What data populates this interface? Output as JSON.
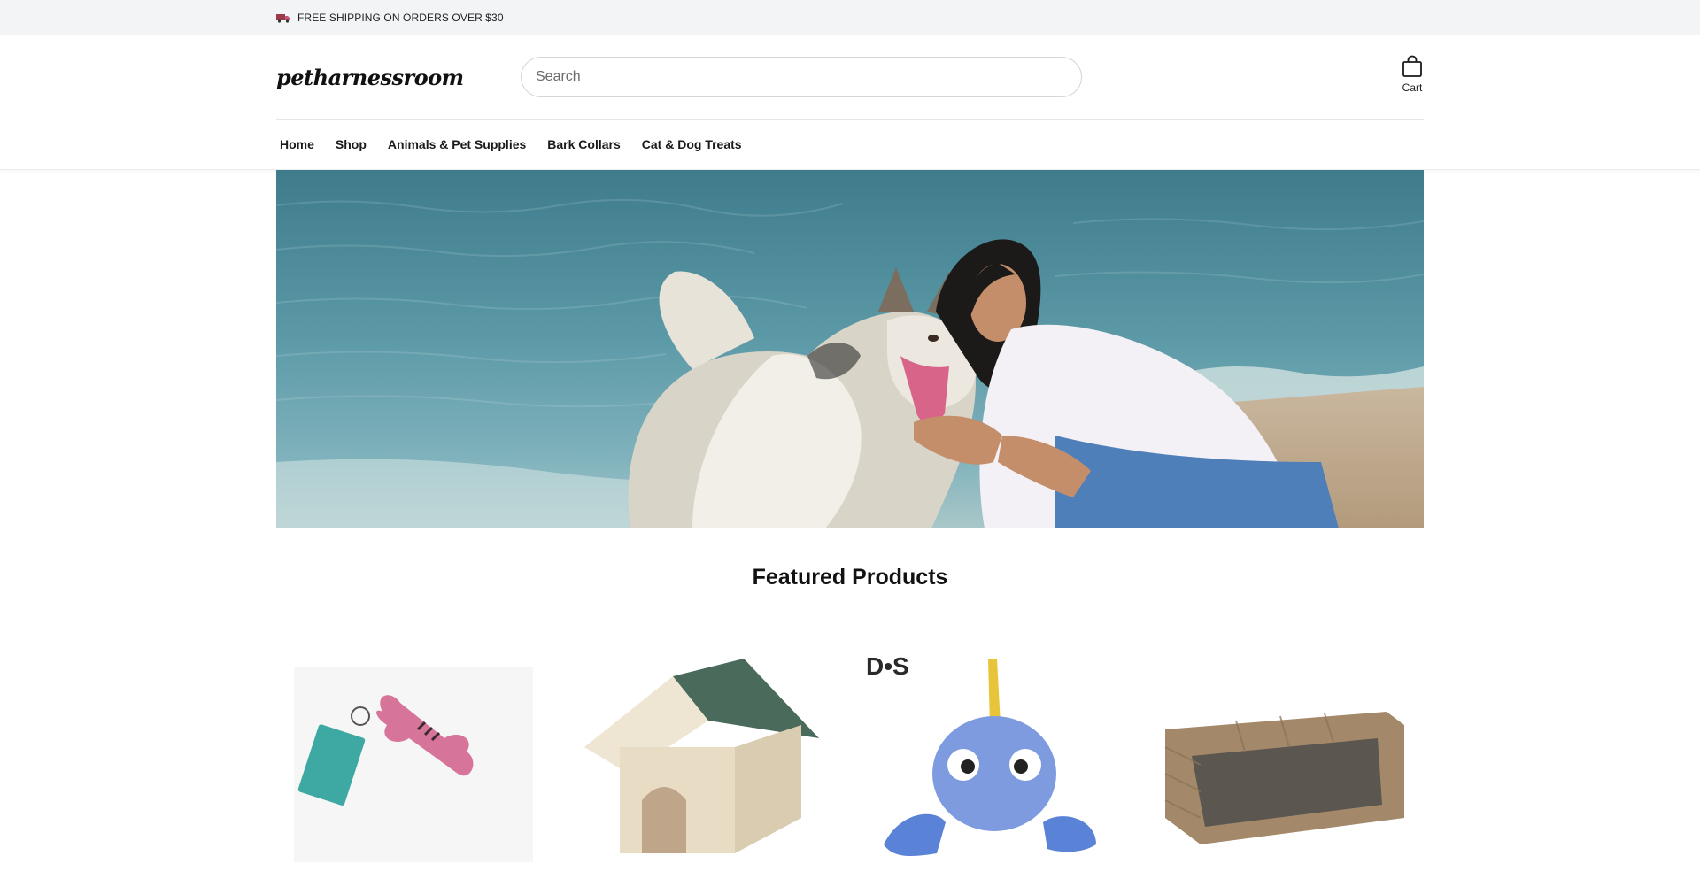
{
  "announcement": {
    "text": "FREE SHIPPING ON ORDERS OVER $30",
    "icon": "truck-icon"
  },
  "header": {
    "logo": "petharnessroom",
    "search_placeholder": "Search",
    "cart_label": "Cart"
  },
  "nav": {
    "items": [
      {
        "label": "Home"
      },
      {
        "label": "Shop"
      },
      {
        "label": "Animals & Pet Supplies"
      },
      {
        "label": "Bark Collars"
      },
      {
        "label": "Cat & Dog Treats"
      }
    ]
  },
  "hero": {
    "image": "woman-hugging-husky-on-beach"
  },
  "featured": {
    "title": "Featured Products",
    "products": [
      {
        "image": "pink-bone-toy-with-eco-tag"
      },
      {
        "image": "wooden-dog-house"
      },
      {
        "image": "blue-plush-fish-toy",
        "brand_mark": "D•S"
      },
      {
        "image": "wicker-dog-bed"
      }
    ]
  },
  "colors": {
    "announcement_bg": "#f3f4f6",
    "text": "#1a1a1a",
    "border": "#d6d6d6"
  }
}
